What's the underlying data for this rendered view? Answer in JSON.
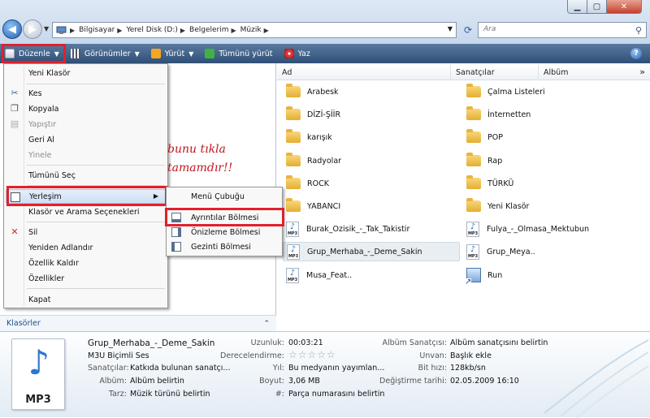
{
  "address": {
    "segments": [
      "Bilgisayar",
      "Yerel Disk (D:)",
      "Belgelerim",
      "Müzik"
    ]
  },
  "search": {
    "placeholder": "Ara"
  },
  "toolbar": {
    "organize": "Düzenle",
    "views": "Görünümler",
    "play": "Yürüt",
    "play_all": "Tümünü yürüt",
    "burn": "Yaz",
    "help": "?"
  },
  "columns": [
    "Ad",
    "Sanatçılar",
    "Albüm"
  ],
  "files": [
    {
      "name": "Arabesk",
      "type": "folder"
    },
    {
      "name": "Çalma Listeleri",
      "type": "folder"
    },
    {
      "name": "DİZİ-ŞİİR",
      "type": "folder"
    },
    {
      "name": "İnternetten",
      "type": "folder"
    },
    {
      "name": "karışık",
      "type": "folder"
    },
    {
      "name": "POP",
      "type": "folder"
    },
    {
      "name": "Radyolar",
      "type": "folder"
    },
    {
      "name": "Rap",
      "type": "folder"
    },
    {
      "name": "ROCK",
      "type": "folder"
    },
    {
      "name": "TÜRKÜ",
      "type": "folder"
    },
    {
      "name": "YABANCI",
      "type": "folder"
    },
    {
      "name": "Yeni Klasör",
      "type": "folder"
    },
    {
      "name": "Burak_Ozisik_-_Tak_Takistir",
      "type": "mp3"
    },
    {
      "name": "Fulya_-_Olmasa_Mektubun",
      "type": "mp3"
    },
    {
      "name": "Grup_Merhaba_-_Deme_Sakin",
      "type": "mp3",
      "selected": true
    },
    {
      "name": "Grup_Meya..",
      "type": "mp3"
    },
    {
      "name": "Musa_Feat..",
      "type": "mp3"
    },
    {
      "name": "Run",
      "type": "shortcut"
    }
  ],
  "menu": {
    "items": [
      {
        "label": "Yeni Klasör",
        "enabled": true
      },
      {
        "label": "Kes",
        "enabled": true,
        "icon": "scissors-icon"
      },
      {
        "label": "Kopyala",
        "enabled": true,
        "icon": "copy-icon"
      },
      {
        "label": "Yapıştır",
        "enabled": false,
        "icon": "paste-icon"
      },
      {
        "label": "Geri Al",
        "enabled": true
      },
      {
        "label": "Yinele",
        "enabled": false
      },
      {
        "label": "Tümünü Seç",
        "enabled": true
      },
      {
        "label": "Yerleşim",
        "enabled": true,
        "icon": "layout-icon",
        "submenu": true,
        "highlighted": true
      },
      {
        "label": "Klasör ve Arama Seçenekleri",
        "enabled": true
      },
      {
        "label": "Sil",
        "enabled": true,
        "icon": "delete-icon"
      },
      {
        "label": "Yeniden Adlandır",
        "enabled": true
      },
      {
        "label": "Özellik Kaldır",
        "enabled": true
      },
      {
        "label": "Özellikler",
        "enabled": true
      },
      {
        "label": "Kapat",
        "enabled": true
      }
    ],
    "submenu": [
      "Menü Çubuğu",
      "Ayrıntılar Bölmesi",
      "Önizleme Bölmesi",
      "Gezinti Bölmesi"
    ]
  },
  "annotation": {
    "line1": "bunu tıkla",
    "line2": "tamamdır!!"
  },
  "folders_label": "Klasörler",
  "details": {
    "icon_label": "MP3",
    "name": "Grup_Merhaba_-_Deme_Sakin",
    "type": "M3U Biçimli Ses",
    "col1": [
      {
        "label": "Sanatçılar:",
        "value": "Katkıda bulunan sanatçı..."
      },
      {
        "label": "Albüm:",
        "value": "Albüm belirtin"
      },
      {
        "label": "Tarz:",
        "value": "Müzik türünü belirtin"
      }
    ],
    "col2": [
      {
        "label": "Uzunluk:",
        "value": "00:03:21"
      },
      {
        "label": "Derecelendirme:",
        "value": "☆☆☆☆☆"
      },
      {
        "label": "Yıl:",
        "value": "Bu medyanın yayımlan..."
      },
      {
        "label": "Boyut:",
        "value": "3,06 MB"
      },
      {
        "label": "#:",
        "value": "Parça numarasını belirtin"
      }
    ],
    "col3": [
      {
        "label": "Albüm Sanatçısı:",
        "value": "Albüm sanatçısını belirtin"
      },
      {
        "label": "Unvan:",
        "value": "Başlık ekle"
      },
      {
        "label": "Bit hızı:",
        "value": "128kb/sn"
      },
      {
        "label": "Değiştirme tarihi:",
        "value": "02.05.2009 16:10"
      }
    ]
  },
  "colors": {
    "highlight_box": "#e0212b",
    "annotation_text": "#c0181f",
    "toolbar": "#3d5e86"
  }
}
